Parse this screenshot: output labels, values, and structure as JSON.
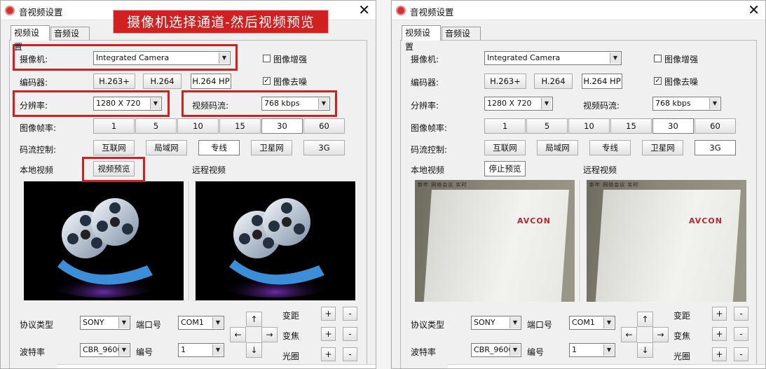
{
  "window_title": "音视频设置",
  "close_glyph": "✕",
  "tabs": {
    "video": "视频设置",
    "audio": "音频设置"
  },
  "banner": "摄像机选择通道-然后视频预览",
  "labels": {
    "camera": "摄像机:",
    "encoder": "编码器:",
    "resolution": "分辨率:",
    "bitrate_stream": "视频码流:",
    "framerate": "图像帧率:",
    "rate_control": "码流控制:",
    "local_video": "本地视频",
    "remote_video": "远程视频",
    "protocol": "协议类型",
    "port": "端口号",
    "baud": "波特率",
    "number": "编号",
    "zoom": "变距",
    "focus": "变焦",
    "iris": "光圈"
  },
  "checkboxes": {
    "enhance": "图像增强",
    "denoise": "图像去噪",
    "enhance_checked": "",
    "denoise_checked": "✓"
  },
  "camera_value": "Integrated Camera",
  "encoders": [
    "H.263+",
    "H.264",
    "H.264 HP"
  ],
  "resolution_value": "1280 X 720",
  "stream_value": "768  kbps",
  "framerates": [
    "1",
    "5",
    "10",
    "15",
    "30",
    "60"
  ],
  "networks": [
    "互联网",
    "局域网",
    "专线",
    "卫星网",
    "3G"
  ],
  "preview_button_left": "视频预览",
  "preview_button_right": "停止预览",
  "protocol_value": "SONY",
  "port_value": "COM1",
  "baud_value": "CBR_9600",
  "number_value": "1",
  "ptz": {
    "up": "↑",
    "down": "↓",
    "left": "←",
    "right": "→",
    "plus": "+",
    "minus": "-"
  },
  "camera_brand": "AVCON",
  "camera_overlay": "新年 网络会议 实时",
  "dropdown_glyph": "▼",
  "colors": {
    "highlight": "#d21f1f"
  }
}
